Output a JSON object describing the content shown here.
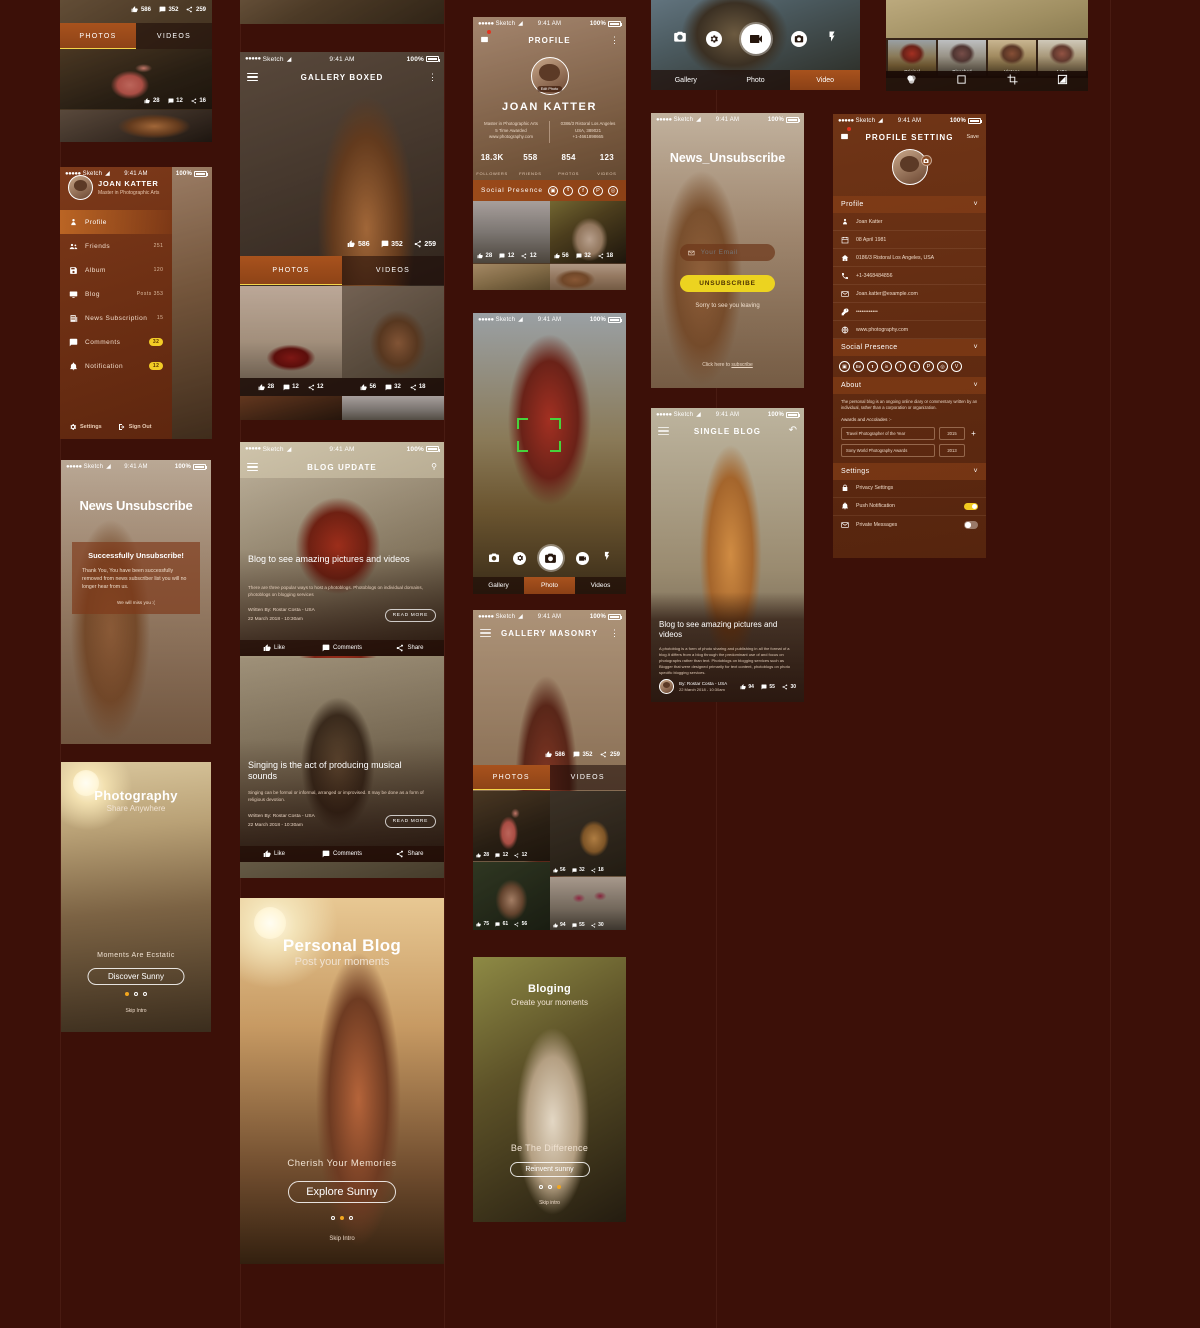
{
  "meta": {
    "background": "#3c1008",
    "accent": "#a8521d",
    "yellow": "#f2c91f"
  },
  "status_bar": {
    "carrier": "Sketch",
    "time": "9:41 AM",
    "battery": "100%",
    "signal_dots": "●●●●●"
  },
  "screens": {
    "gallery_boxed_top": {
      "stats": {
        "likes": "586",
        "comments": "352",
        "shares": "259"
      },
      "tabs": [
        "PHOTOS",
        "VIDEOS"
      ],
      "photo_stats": {
        "likes": "28",
        "comments": "12",
        "shares": "16"
      }
    },
    "sidebar": {
      "user": {
        "name": "JOAN KATTER",
        "role": "Master in Photographic Arts"
      },
      "items": [
        {
          "label": "Profile",
          "icon": "person-icon",
          "count": "",
          "badge": "",
          "active": true
        },
        {
          "label": "Friends",
          "icon": "friends-icon",
          "count": "251",
          "badge": "",
          "active": false
        },
        {
          "label": "Album",
          "icon": "album-icon",
          "count": "120",
          "badge": "",
          "active": false
        },
        {
          "label": "Blog",
          "icon": "blog-icon",
          "count": "Posts 353",
          "badge": "",
          "active": false
        },
        {
          "label": "News Subscription",
          "icon": "news-icon",
          "count": "15",
          "badge": "",
          "active": false
        },
        {
          "label": "Comments",
          "icon": "comments-icon",
          "count": "",
          "badge": "32",
          "active": false
        },
        {
          "label": "Notification",
          "icon": "bell-icon",
          "count": "",
          "badge": "12",
          "active": false
        }
      ],
      "footer": {
        "settings": "Settings",
        "signout": "Sign Out"
      }
    },
    "news_unsubscribe_success": {
      "title": "News Unsubscribe",
      "card_title": "Successfully Unsubscribe!",
      "body": "Thank You, You have been successfully removed from news subscriber list you will no longer hear from us.",
      "note": "We will miss you  :("
    },
    "onboarding_photography": {
      "title": "Photography",
      "subtitle": "Share Anywhere",
      "tagline": "Moments Are Ecstatic",
      "cta": "Discover Sunny",
      "skip": "Skip Intro",
      "active_dot": 0
    },
    "gallery_boxed": {
      "title": "GALLERY BOXED",
      "hero_stats": {
        "likes": "586",
        "comments": "352",
        "shares": "259"
      },
      "tabs": [
        "PHOTOS",
        "VIDEOS"
      ],
      "grid": [
        {
          "likes": "28",
          "comments": "12",
          "shares": "12"
        },
        {
          "likes": "56",
          "comments": "32",
          "shares": "18"
        }
      ]
    },
    "blog_update": {
      "title": "BLOG UPDATE",
      "posts": [
        {
          "title": "Blog to see amazing pictures and videos",
          "excerpt": "There are three popular ways to host a photoblogs. Photoblogs on individual domains, photoblogs on blogging services",
          "author": "Written By:  Rostar Costa - USA",
          "date": "22 March 2018 - 10:30am",
          "read_more": "READ MORE",
          "actions": [
            "Like",
            "Comments",
            "Share"
          ]
        },
        {
          "title": "Singing is the act of producing musical sounds",
          "excerpt": "Singing can be formal or informal, arranged or improvised. It may be done as a form of religious devotion.",
          "author": "Written By:  Rostar Costa - USA",
          "date": "22 March 2018 - 10:30am",
          "read_more": "READ MORE",
          "actions": [
            "Like",
            "Comments",
            "Share"
          ]
        }
      ]
    },
    "onboarding_personal_blog": {
      "title": "Personal Blog",
      "subtitle": "Post your moments",
      "tagline": "Cherish Your Memories",
      "cta": "Explore Sunny",
      "skip": "Skip Intro",
      "active_dot": 1
    },
    "profile": {
      "title": "PROFILE",
      "name": "JOAN KATTER",
      "edit_photo": "Edit Photo",
      "left_col": "Master in Photographic Arts\n5 Time Awarded\nwww.photography.com",
      "right_col": "0386/3 Ristoral Los Angeles\nUSA, 389021\n+1-4661898665",
      "stats": [
        {
          "value": "18.3K",
          "label": "FOLLOWERS"
        },
        {
          "value": "558",
          "label": "FRIENDS"
        },
        {
          "value": "854",
          "label": "PHOTOS"
        },
        {
          "value": "123",
          "label": "VIDEOS"
        }
      ],
      "social_label": "Social Presence",
      "social_icons": [
        "instagram-icon",
        "twitter-icon",
        "facebook-icon",
        "pinterest-icon",
        "dribbble-icon"
      ],
      "grid": [
        {
          "likes": "28",
          "comments": "12",
          "shares": "12"
        },
        {
          "likes": "56",
          "comments": "32",
          "shares": "18"
        }
      ]
    },
    "camera_photo": {
      "controls": [
        "switch-camera-icon",
        "settings-icon",
        "shutter-icon",
        "video-icon",
        "flash-icon"
      ],
      "tabs": [
        "Gallery",
        "Photo",
        "Videos"
      ],
      "active_tab": "Photo"
    },
    "camera_video": {
      "controls": [
        "switch-camera-icon",
        "settings-icon",
        "video-icon",
        "shutter-icon",
        "flash-icon"
      ],
      "tabs": [
        "Gallery",
        "Photo",
        "Video"
      ],
      "active_tab": "Video"
    },
    "gallery_masonry": {
      "title": "GALLERY MASONRY",
      "hero_stats": {
        "likes": "586",
        "comments": "352",
        "shares": "259"
      },
      "tabs": [
        "PHOTOS",
        "VIDEOS"
      ],
      "grid": [
        {
          "likes": "28",
          "comments": "12",
          "shares": "12"
        },
        {
          "likes": "56",
          "comments": "32",
          "shares": "18"
        },
        {
          "likes": "75",
          "comments": "61",
          "shares": "56"
        },
        {
          "likes": "94",
          "comments": "55",
          "shares": "30"
        }
      ]
    },
    "onboarding_bloging": {
      "title": "Bloging",
      "subtitle": "Create your moments",
      "tagline": "Be The Difference",
      "cta": "Reinvent sunny",
      "skip": "Skip intro",
      "active_dot": 2
    },
    "news_unsubscribe_form": {
      "title": "News_Unsubscribe",
      "email_placeholder": "Your Email",
      "button": "UNSUBSCRIBE",
      "note": "Sorry to see you leaving",
      "footer_prefix": "Click here to ",
      "footer_link": "subscribe"
    },
    "single_blog": {
      "title": "SINGLE BLOG",
      "headline": "Blog to see amazing pictures and videos",
      "body": "A photoblog is a form of photo sharing and publishing in all the format of a blog.It differs from a blog through the predominant use of and focus on photographs rather than text. Photoblogs on blogging services such as Blogger that were designed primarily for text content, photoblogs on photo specific blogging services.",
      "author": "By:  Rostar Costa - USA",
      "date": "22 March 2018 - 10:30am",
      "stats": {
        "likes": "94",
        "comments": "55",
        "shares": "30"
      }
    },
    "photo_filters": {
      "filters": [
        {
          "label": "Original",
          "selected": true
        },
        {
          "label": "Bleached",
          "selected": false
        },
        {
          "label": "Vintage",
          "selected": false
        },
        {
          "label": "Latte",
          "selected": false
        }
      ],
      "tools": [
        "filter-icon",
        "frame-icon",
        "crop-icon",
        "exposure-icon"
      ]
    },
    "profile_setting": {
      "title": "PROFILE SETTING",
      "save": "Save",
      "sections": {
        "profile": {
          "label": "Profile",
          "fields": [
            {
              "icon": "person-icon",
              "value": "Joan Katter"
            },
            {
              "icon": "calendar-icon",
              "value": "08 April 1981"
            },
            {
              "icon": "home-icon",
              "value": "0186/3 Ristoral Los Angeles, USA"
            },
            {
              "icon": "phone-icon",
              "value": "+1-3468484856"
            },
            {
              "icon": "mail-icon",
              "value": "Joan.katter@example.com"
            },
            {
              "icon": "key-icon",
              "value": "••••••••••••"
            },
            {
              "icon": "globe-icon",
              "value": "www.photography.com"
            }
          ]
        },
        "social": {
          "label": "Social Presence",
          "icons": [
            "instagram-icon",
            "behance-icon",
            "twitter-icon",
            "linkedin-icon",
            "facebook-icon",
            "tumblr-icon",
            "pinterest-icon",
            "dribbble-icon",
            "vimeo-icon"
          ]
        },
        "about": {
          "label": "About",
          "text": "The personal blog is an ongoing online diary or commentary written by an individual, rather than a corporation or organization.",
          "awards_label": "Awards and Accolades :-",
          "awards": [
            {
              "name": "Travel Photographer of the Year",
              "year": "2015"
            },
            {
              "name": "Sony World Photography Awards",
              "year": "2013"
            }
          ]
        },
        "settings": {
          "label": "Settings",
          "rows": [
            {
              "icon": "lock-icon",
              "label": "Privacy Settings",
              "toggle": ""
            },
            {
              "icon": "bell-icon",
              "label": "Push Notification",
              "toggle": "on"
            },
            {
              "icon": "mail-lock-icon",
              "label": "Private Messages",
              "toggle": "off"
            }
          ]
        }
      }
    }
  }
}
